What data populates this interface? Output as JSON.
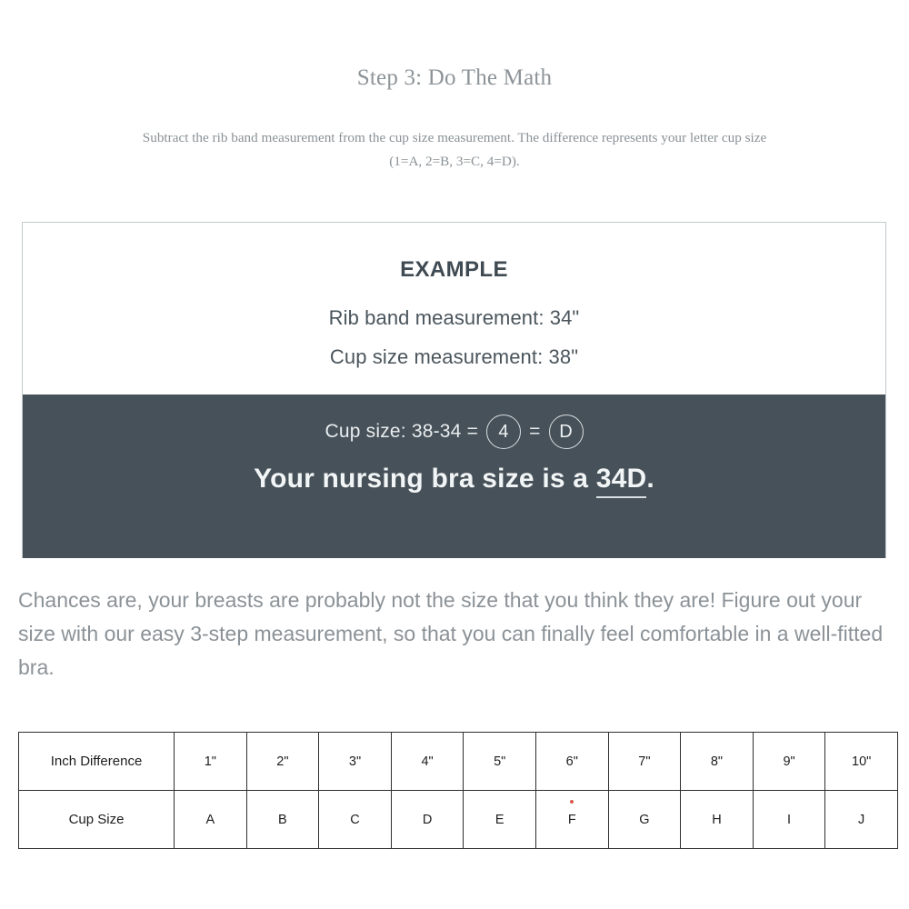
{
  "page": {
    "title": "Step 3: Do The Math",
    "intro_line1": "Subtract the rib band measurement from the cup size measurement. The difference represents your letter cup size",
    "intro_line2": "(1=A, 2=B, 3=C, 4=D).",
    "body_paragraph": "Chances are, your breasts are probably not the size that you think they are! Figure out your size with our easy 3-step measurement, so that you can finally feel comfortable in a well-fitted bra."
  },
  "example_card": {
    "heading": "EXAMPLE",
    "rib_band_line": "Rib band measurement: 34\"",
    "cup_size_line": "Cup size measurement: 38\"",
    "calc_prefix": "Cup size: 38-34 =",
    "calc_number": "4",
    "calc_equals": "=",
    "calc_letter": "D",
    "result_prefix": "Your nursing bra size is a ",
    "result_size": "34D",
    "result_suffix": "."
  },
  "colors": {
    "dark_panel": "#475159",
    "muted_text": "#8b9297",
    "card_border": "#c3c9cd",
    "red_dot": "#d9594f"
  },
  "size_table": {
    "rows": [
      {
        "label": "Inch Difference",
        "values": [
          "1\"",
          "2\"",
          "3\"",
          "4\"",
          "5\"",
          "6\"",
          "7\"",
          "8\"",
          "9\"",
          "10\""
        ]
      },
      {
        "label": "Cup Size",
        "values": [
          "A",
          "B",
          "C",
          "D",
          "E",
          "F",
          "G",
          "H",
          "I",
          "J"
        ]
      }
    ]
  }
}
